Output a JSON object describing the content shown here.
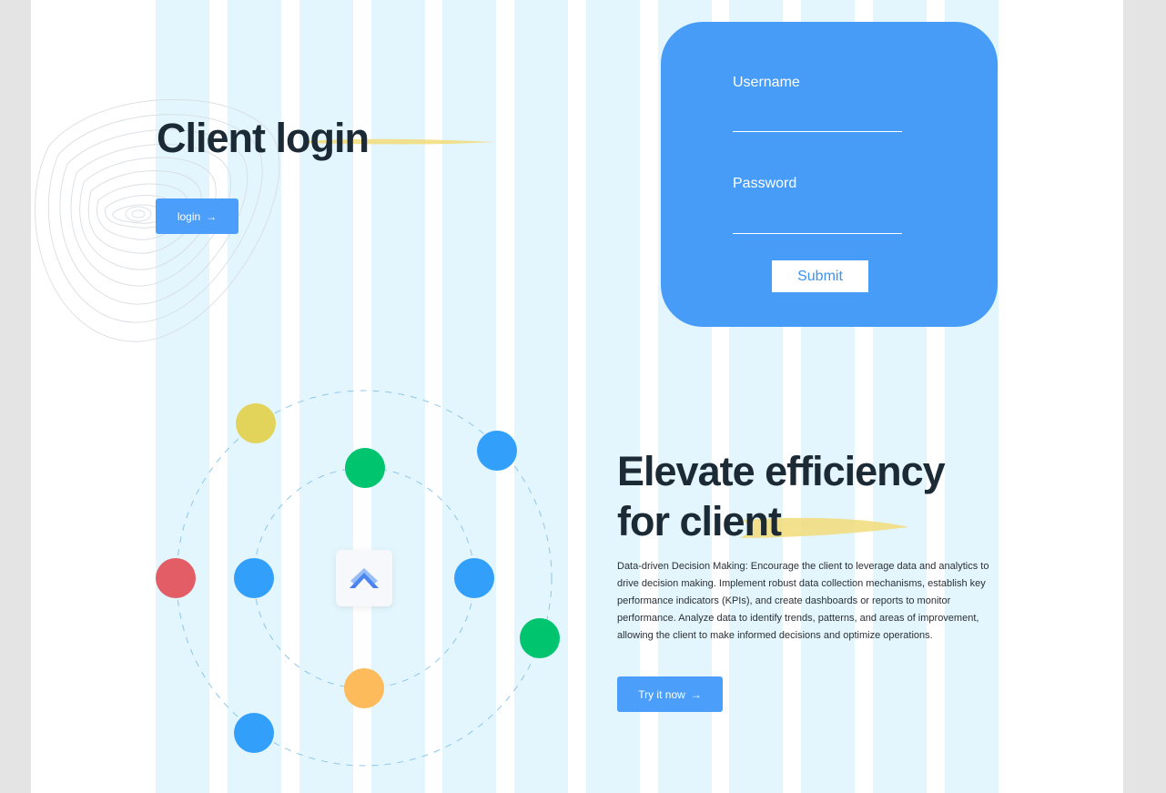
{
  "colors": {
    "accent": "#4b9ef9",
    "card": "#479cf8",
    "heading": "#1c2a36",
    "grid_column": "#e3f6fd",
    "highlight_stroke": "#f2dc7a",
    "dot_yellow": "#e2d45a",
    "dot_green": "#00c46e",
    "dot_blue": "#32a0fb",
    "dot_red": "#e35d66",
    "dot_orange": "#fdbb5b"
  },
  "hero": {
    "title": "Client login",
    "login_button": "login"
  },
  "login_form": {
    "username_label": "Username",
    "password_label": "Password",
    "username_value": "",
    "password_value": "",
    "submit_label": "Submit"
  },
  "feature": {
    "title_line1": "Elevate efficiency",
    "title_line2": "for client",
    "description": "Data-driven Decision Making: Encourage the client to leverage data and analytics to drive decision making. Implement robust data collection mechanisms, establish key performance indicators (KPIs), and create dashboards or reports to monitor performance. Analyze data to identify trends, patterns, and areas of improvement, allowing the client to make informed decisions and optimize operations.",
    "cta_label": "Try it now"
  },
  "icons": {
    "arrow": "arrow-right-icon",
    "logo": "chevron-up-logo-icon"
  }
}
